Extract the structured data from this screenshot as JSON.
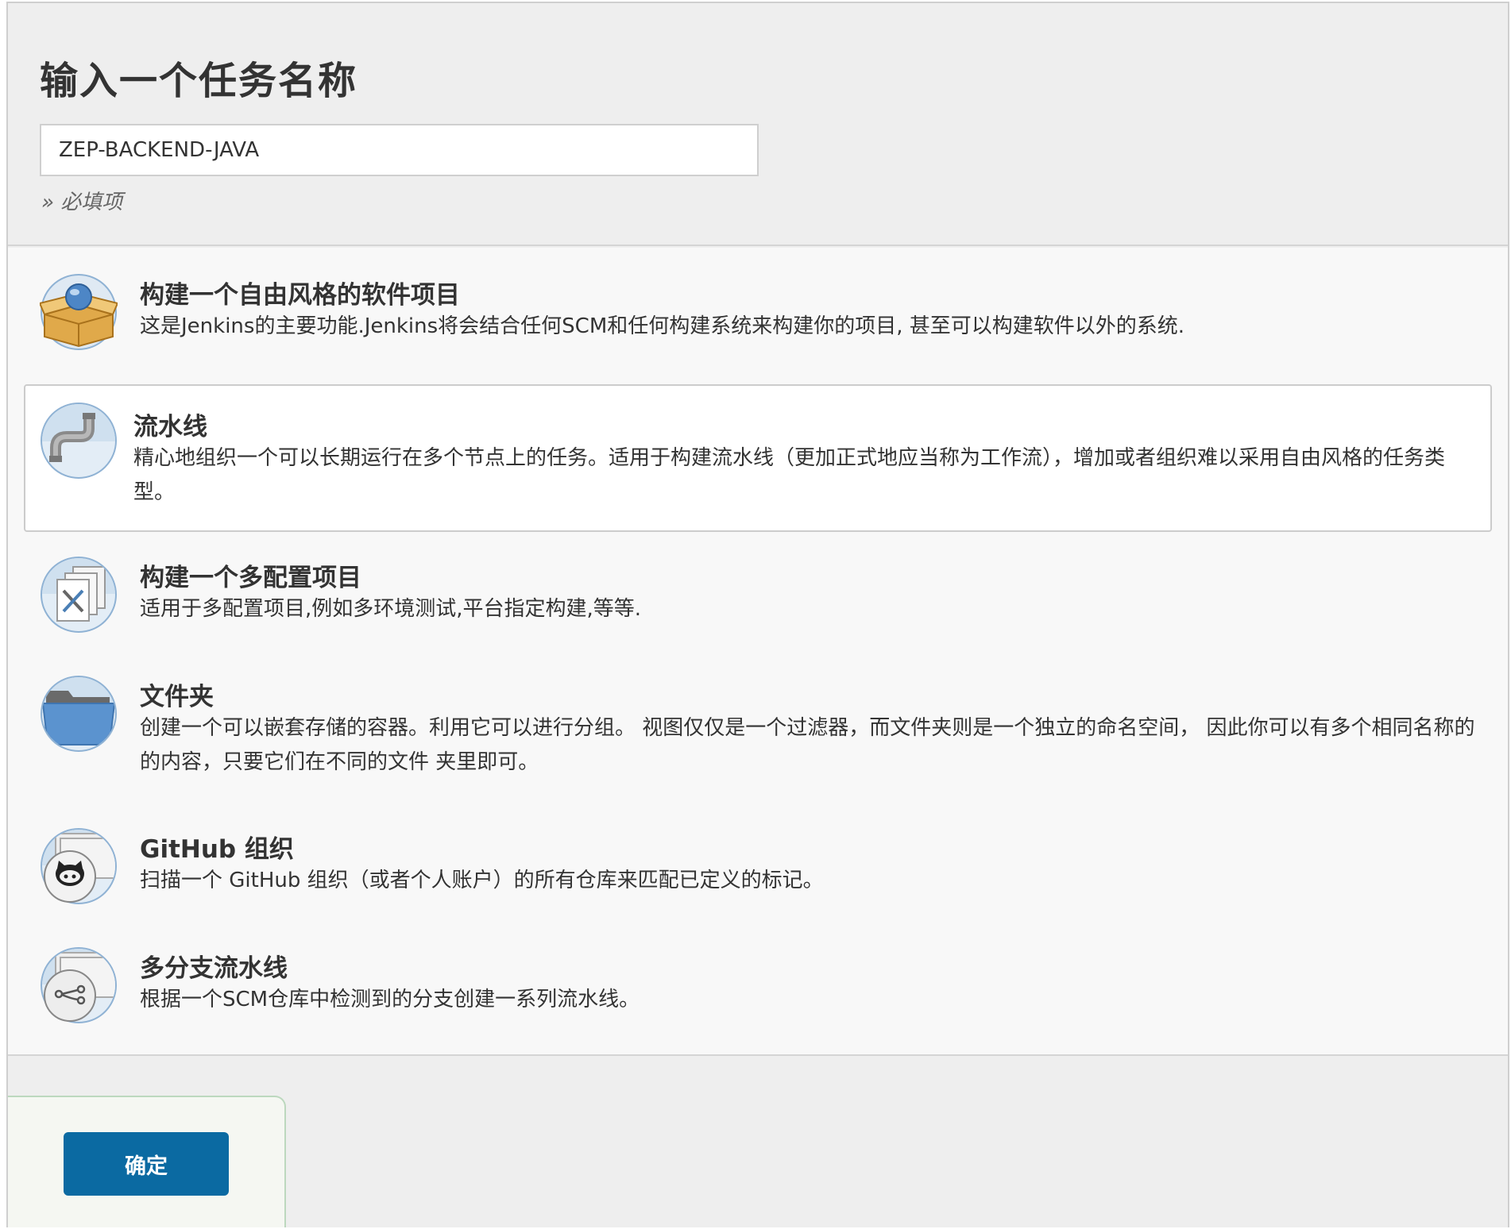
{
  "header": {
    "title": "输入一个任务名称",
    "name_input_value": "ZEP-BACKEND-JAVA",
    "required_note": "» 必填项"
  },
  "items": [
    {
      "title": "构建一个自由风格的软件项目",
      "description": "这是Jenkins的主要功能.Jenkins将会结合任何SCM和任何构建系统来构建你的项目, 甚至可以构建软件以外的系统.",
      "icon": "freestyle-project-icon"
    },
    {
      "title": "流水线",
      "description": "精心地组织一个可以长期运行在多个节点上的任务。适用于构建流水线（更加正式地应当称为工作流），增加或者组织难以采用自由风格的任务类型。",
      "icon": "pipeline-icon",
      "selected": true
    },
    {
      "title": "构建一个多配置项目",
      "description": "适用于多配置项目,例如多环境测试,平台指定构建,等等.",
      "icon": "multi-config-project-icon"
    },
    {
      "title": "文件夹",
      "description": "创建一个可以嵌套存储的容器。利用它可以进行分组。 视图仅仅是一个过滤器，而文件夹则是一个独立的命名空间， 因此你可以有多个相同名称的的内容，只要它们在不同的文件 夹里即可。",
      "icon": "folder-icon"
    },
    {
      "title": "GitHub 组织",
      "description": "扫描一个 GitHub 组织（或者个人账户）的所有仓库来匹配已定义的标记。",
      "icon": "github-organization-icon"
    },
    {
      "title": "多分支流水线",
      "description": "根据一个SCM仓库中检测到的分支创建一系列流水线。",
      "icon": "multibranch-pipeline-icon"
    }
  ],
  "footer": {
    "ok_label": "确定"
  },
  "colors": {
    "ok_button": "#0b6aa2",
    "selected_border": "#cccccc"
  }
}
